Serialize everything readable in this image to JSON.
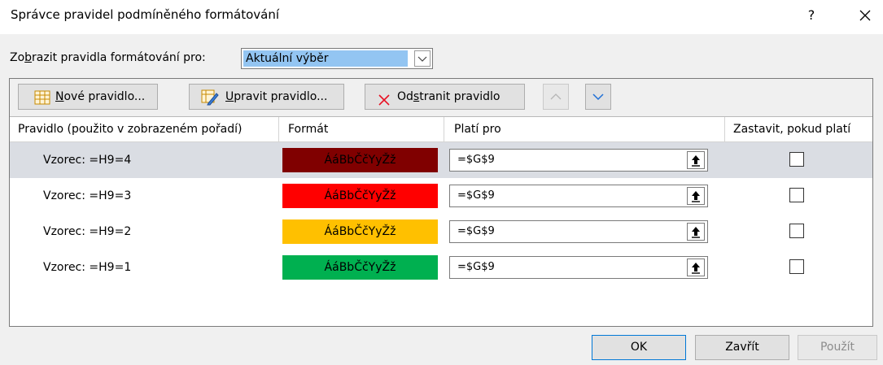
{
  "dialog": {
    "title": "Správce pravidel podmíněného formátování",
    "help_label": "?",
    "close_label": "×"
  },
  "scope": {
    "label_pre": "Zo",
    "label_key": "b",
    "label_post": "razit pravidla formátování pro:",
    "selected": "Aktuální výběr"
  },
  "toolbar": {
    "new_rule_key": "N",
    "new_rule_rest": "ové pravidlo...",
    "edit_rule_key": "U",
    "edit_rule_rest": "pravit pravidlo...",
    "delete_rule_pre": "Od",
    "delete_rule_key": "s",
    "delete_rule_post": "tranit pravidlo"
  },
  "columns": {
    "rule": "Pravidlo (použito v zobrazeném pořadí)",
    "format": "Formát",
    "applies_to": "Platí pro",
    "stop_if_true": "Zastavit, pokud platí"
  },
  "rules": [
    {
      "rule": "Vzorec: =H9=4",
      "preview": "ÁáBbČčYyŽž",
      "bg": "#800000",
      "fg": "#000000",
      "applies_to": "=$G$9",
      "stop": false,
      "selected": true
    },
    {
      "rule": "Vzorec: =H9=3",
      "preview": "ÁáBbČčYyŽž",
      "bg": "#ff0000",
      "fg": "#000000",
      "applies_to": "=$G$9",
      "stop": false,
      "selected": false
    },
    {
      "rule": "Vzorec: =H9=2",
      "preview": "ÁáBbČčYyŽž",
      "bg": "#ffc000",
      "fg": "#000000",
      "applies_to": "=$G$9",
      "stop": false,
      "selected": false
    },
    {
      "rule": "Vzorec: =H9=1",
      "preview": "ÁáBbČčYyŽž",
      "bg": "#00b050",
      "fg": "#000000",
      "applies_to": "=$G$9",
      "stop": false,
      "selected": false
    }
  ],
  "buttons": {
    "ok": "OK",
    "close": "Zavřít",
    "apply": "Použít"
  }
}
